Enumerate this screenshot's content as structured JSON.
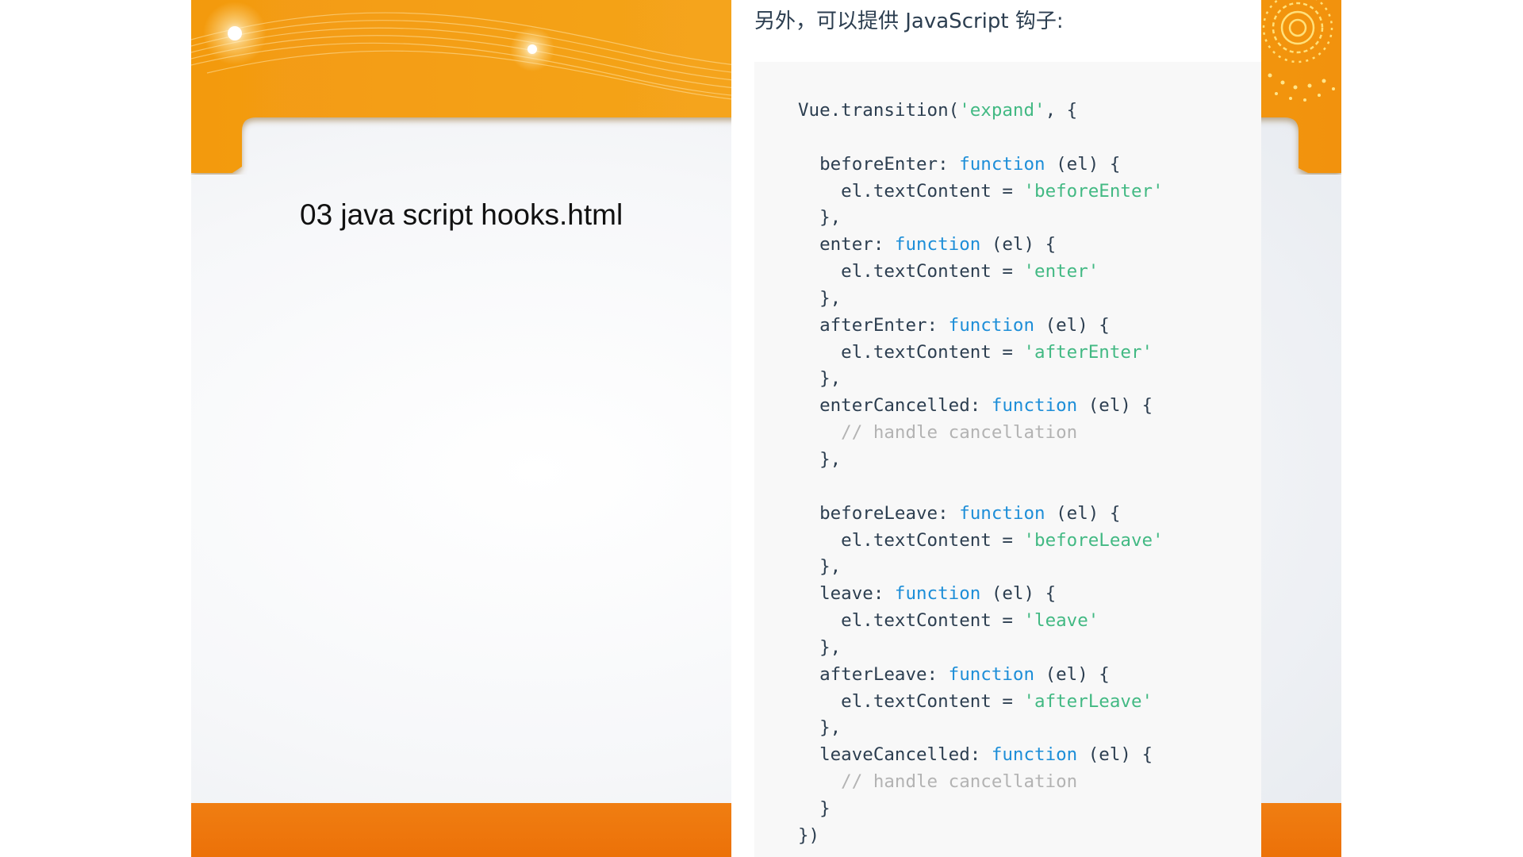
{
  "slide": {
    "title": "03 java script hooks.html",
    "colors": {
      "header_orange": "#f39a10",
      "footer_orange": "#ee760c"
    }
  },
  "doc": {
    "intro_text": "另外，可以提供 JavaScript 钩子:",
    "code_lines": [
      [
        {
          "t": "p",
          "v": "Vue.transition("
        },
        {
          "t": "s",
          "v": "'expand'"
        },
        {
          "t": "p",
          "v": ", {"
        }
      ],
      [],
      [
        {
          "t": "p",
          "v": "  beforeEnter: "
        },
        {
          "t": "k",
          "v": "function"
        },
        {
          "t": "p",
          "v": " (el) {"
        }
      ],
      [
        {
          "t": "p",
          "v": "    el.textContent = "
        },
        {
          "t": "s",
          "v": "'beforeEnter'"
        }
      ],
      [
        {
          "t": "p",
          "v": "  },"
        }
      ],
      [
        {
          "t": "p",
          "v": "  enter: "
        },
        {
          "t": "k",
          "v": "function"
        },
        {
          "t": "p",
          "v": " (el) {"
        }
      ],
      [
        {
          "t": "p",
          "v": "    el.textContent = "
        },
        {
          "t": "s",
          "v": "'enter'"
        }
      ],
      [
        {
          "t": "p",
          "v": "  },"
        }
      ],
      [
        {
          "t": "p",
          "v": "  afterEnter: "
        },
        {
          "t": "k",
          "v": "function"
        },
        {
          "t": "p",
          "v": " (el) {"
        }
      ],
      [
        {
          "t": "p",
          "v": "    el.textContent = "
        },
        {
          "t": "s",
          "v": "'afterEnter'"
        }
      ],
      [
        {
          "t": "p",
          "v": "  },"
        }
      ],
      [
        {
          "t": "p",
          "v": "  enterCancelled: "
        },
        {
          "t": "k",
          "v": "function"
        },
        {
          "t": "p",
          "v": " (el) {"
        }
      ],
      [
        {
          "t": "c",
          "v": "    // handle cancellation"
        }
      ],
      [
        {
          "t": "p",
          "v": "  },"
        }
      ],
      [],
      [
        {
          "t": "p",
          "v": "  beforeLeave: "
        },
        {
          "t": "k",
          "v": "function"
        },
        {
          "t": "p",
          "v": " (el) {"
        }
      ],
      [
        {
          "t": "p",
          "v": "    el.textContent = "
        },
        {
          "t": "s",
          "v": "'beforeLeave'"
        }
      ],
      [
        {
          "t": "p",
          "v": "  },"
        }
      ],
      [
        {
          "t": "p",
          "v": "  leave: "
        },
        {
          "t": "k",
          "v": "function"
        },
        {
          "t": "p",
          "v": " (el) {"
        }
      ],
      [
        {
          "t": "p",
          "v": "    el.textContent = "
        },
        {
          "t": "s",
          "v": "'leave'"
        }
      ],
      [
        {
          "t": "p",
          "v": "  },"
        }
      ],
      [
        {
          "t": "p",
          "v": "  afterLeave: "
        },
        {
          "t": "k",
          "v": "function"
        },
        {
          "t": "p",
          "v": " (el) {"
        }
      ],
      [
        {
          "t": "p",
          "v": "    el.textContent = "
        },
        {
          "t": "s",
          "v": "'afterLeave'"
        }
      ],
      [
        {
          "t": "p",
          "v": "  },"
        }
      ],
      [
        {
          "t": "p",
          "v": "  leaveCancelled: "
        },
        {
          "t": "k",
          "v": "function"
        },
        {
          "t": "p",
          "v": " (el) {"
        }
      ],
      [
        {
          "t": "c",
          "v": "    // handle cancellation"
        }
      ],
      [
        {
          "t": "p",
          "v": "  }"
        }
      ],
      [
        {
          "t": "p",
          "v": "})"
        }
      ]
    ],
    "colors": {
      "plain": "#2c3e50",
      "keyword": "#1d8ed8",
      "string": "#42b983",
      "comment": "#b3b3b3",
      "code_background": "#f8f8f8"
    }
  }
}
